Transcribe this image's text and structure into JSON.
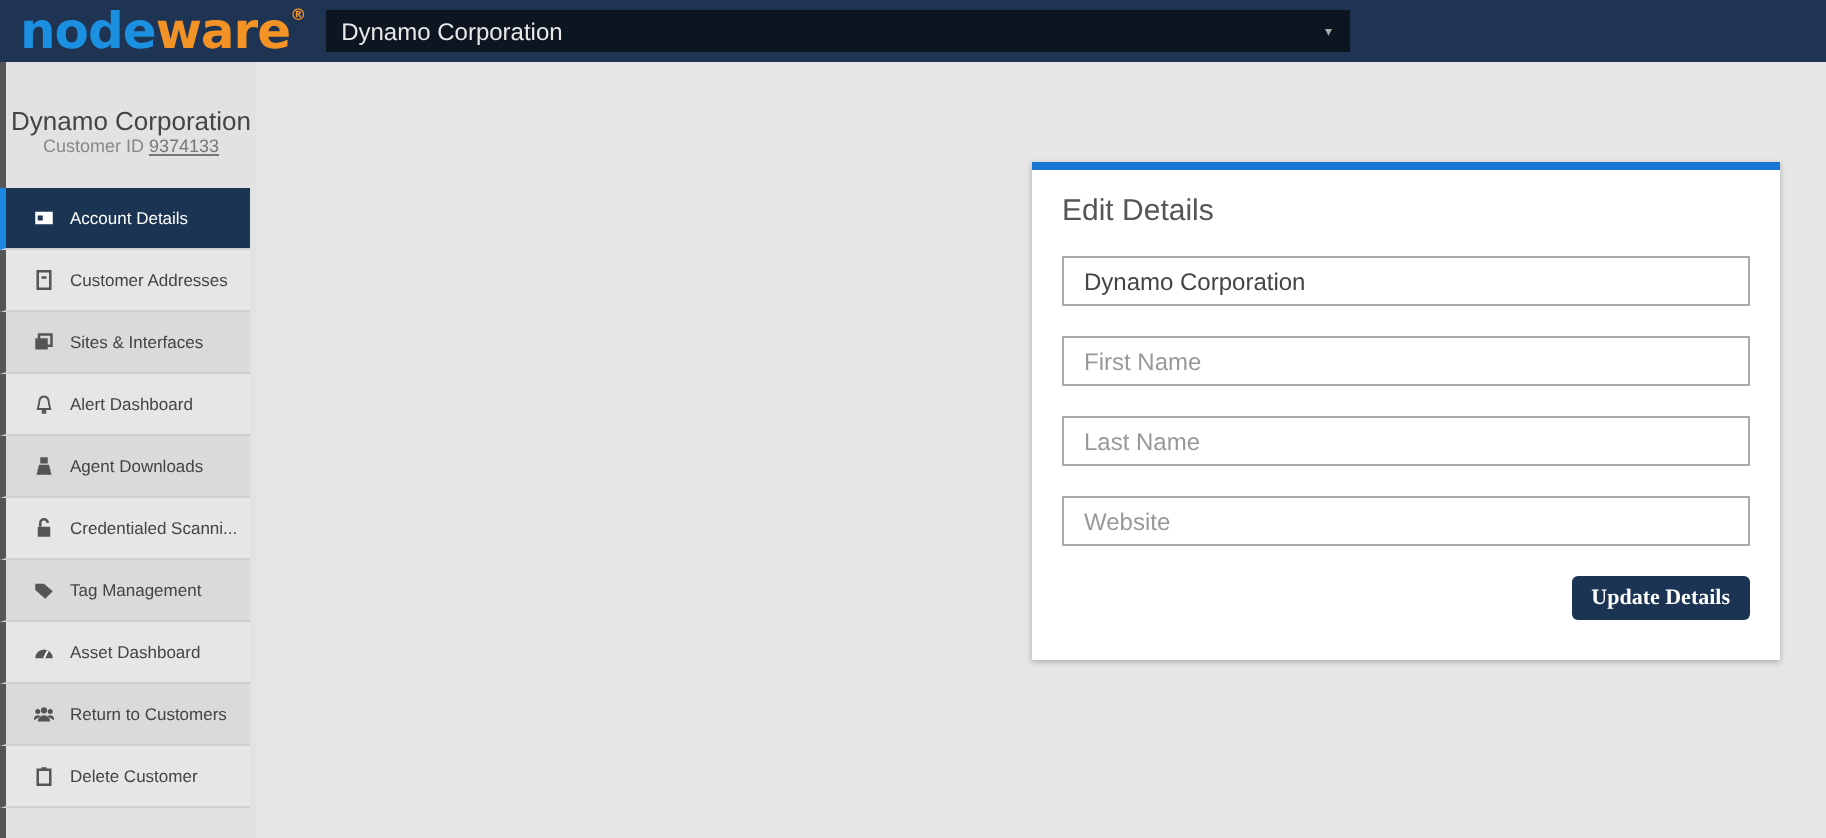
{
  "header": {
    "logo": {
      "part_1": "node",
      "part_2": "ware",
      "mark": "®"
    },
    "org_select": {
      "value": "Dynamo Corporation",
      "arrow": "▾"
    }
  },
  "sidebar": {
    "customer_name": "Dynamo Corporation",
    "customer_id_label": "Customer ID",
    "customer_id": "9374133",
    "items": [
      {
        "label": "Account Details",
        "selected": true
      },
      {
        "label": "Customer Addresses",
        "selected": false
      },
      {
        "label": "Sites & Interfaces",
        "selected": false
      },
      {
        "label": "Alert Dashboard",
        "selected": false
      },
      {
        "label": "Agent Downloads",
        "selected": false
      },
      {
        "label": "Credentialed Scanni...",
        "selected": false
      },
      {
        "label": "Tag Management",
        "selected": false
      },
      {
        "label": "Asset Dashboard",
        "selected": false
      },
      {
        "label": "Return to Customers",
        "selected": false
      },
      {
        "label": "Delete Customer",
        "selected": false
      }
    ]
  },
  "edit_card": {
    "title": "Edit Details",
    "fields": [
      {
        "value": "Dynamo Corporation"
      },
      {
        "placeholder": "First Name"
      },
      {
        "placeholder": "Last Name"
      },
      {
        "placeholder": "Website"
      }
    ],
    "button": "Update Details"
  }
}
